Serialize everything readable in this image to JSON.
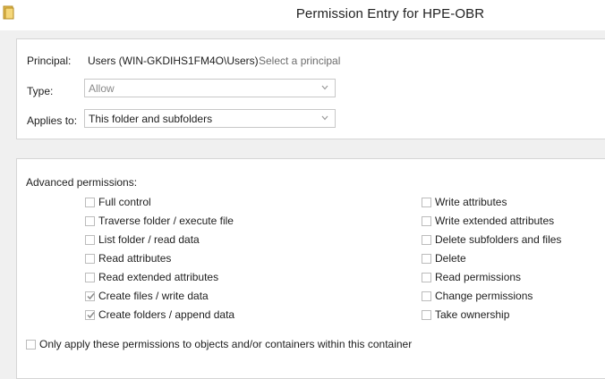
{
  "window": {
    "title": "Permission Entry for HPE-OBR",
    "icon": "folder-icon"
  },
  "principal": {
    "label": "Principal:",
    "value": "Users (WIN-GKDIHS1FM4O\\Users)",
    "select_link": "Select a principal"
  },
  "type": {
    "label": "Type:",
    "value": "Allow"
  },
  "applies_to": {
    "label": "Applies to:",
    "value": "This folder and subfolders"
  },
  "advanced": {
    "heading": "Advanced permissions:",
    "left": [
      {
        "label": "Full control",
        "checked": false
      },
      {
        "label": "Traverse folder / execute file",
        "checked": false
      },
      {
        "label": "List folder / read data",
        "checked": false
      },
      {
        "label": "Read attributes",
        "checked": false
      },
      {
        "label": "Read extended attributes",
        "checked": false
      },
      {
        "label": "Create files / write data",
        "checked": true
      },
      {
        "label": "Create folders / append data",
        "checked": true
      }
    ],
    "right": [
      {
        "label": "Write attributes",
        "checked": false
      },
      {
        "label": "Write extended attributes",
        "checked": false
      },
      {
        "label": "Delete subfolders and files",
        "checked": false
      },
      {
        "label": "Delete",
        "checked": false
      },
      {
        "label": "Read permissions",
        "checked": false
      },
      {
        "label": "Change permissions",
        "checked": false
      },
      {
        "label": "Take ownership",
        "checked": false
      }
    ]
  },
  "only_apply": {
    "label": "Only apply these permissions to objects and/or containers within this container",
    "checked": false
  }
}
